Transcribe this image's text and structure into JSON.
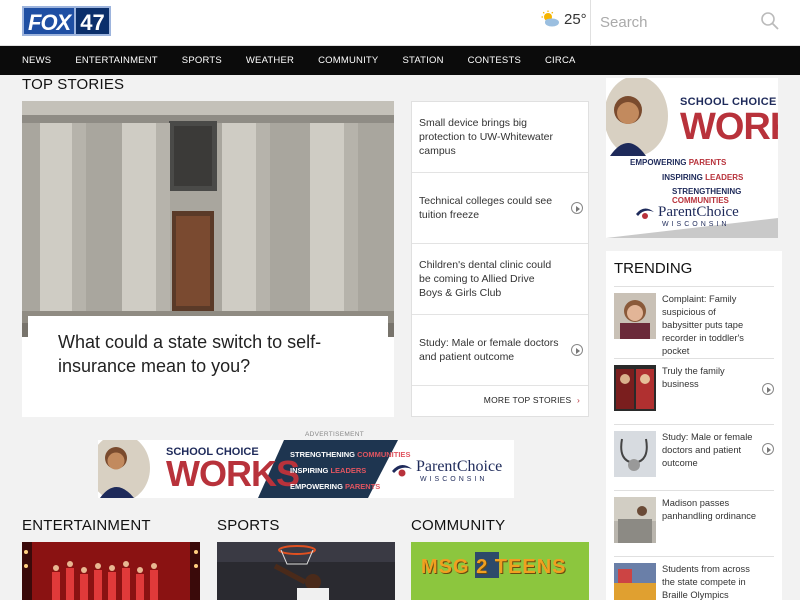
{
  "header": {
    "logo_text": "FOX",
    "logo_number": "47",
    "temperature": "25°",
    "search_placeholder": "Search"
  },
  "nav": {
    "items": [
      {
        "label": "NEWS"
      },
      {
        "label": "ENTERTAINMENT"
      },
      {
        "label": "SPORTS"
      },
      {
        "label": "WEATHER"
      },
      {
        "label": "COMMUNITY"
      },
      {
        "label": "STATION"
      },
      {
        "label": "CONTESTS"
      },
      {
        "label": "CIRCA"
      }
    ]
  },
  "top_stories": {
    "title": "TOP STORIES",
    "hero_headline": "What could a state switch to self-insurance mean to you?",
    "list": [
      {
        "text": "Small device brings big protection to UW-Whitewater campus",
        "video": false
      },
      {
        "text": "Technical colleges could see tuition freeze",
        "video": true
      },
      {
        "text": "Children's dental clinic could be coming to Allied Drive Boys & Girls Club",
        "video": false
      },
      {
        "text": "Study: Male or female doctors and patient outcome",
        "video": true
      }
    ],
    "more_label": "MORE TOP STORIES"
  },
  "ad_right": {
    "line1": "SCHOOL CHOICE",
    "line2": "WORKS",
    "tag1_a": "EMPOWERING",
    "tag1_b": "PARENTS",
    "tag2_a": "INSPIRING",
    "tag2_b": "LEADERS",
    "tag3_a": "STRENGTHENING",
    "tag3_b": "COMMUNITIES",
    "brand": "ParentChoice",
    "brand_sub": "WISCONSIN"
  },
  "trending": {
    "title": "TRENDING",
    "items": [
      {
        "text": "Complaint: Family suspicious of babysitter puts tape recorder in toddler's pocket",
        "video": false
      },
      {
        "text": "Truly the family business",
        "video": true
      },
      {
        "text": "Study: Male or female doctors and patient outcome",
        "video": true
      },
      {
        "text": "Madison passes panhandling ordinance",
        "video": false
      },
      {
        "text": "Students from across the state compete in Braille Olympics",
        "video": false
      }
    ]
  },
  "banner_ad": {
    "label": "ADVERTISEMENT",
    "line1": "SCHOOL CHOICE",
    "line2": "WORKS",
    "tag1_a": "STRENGTHENING",
    "tag1_b": "COMMUNITIES",
    "tag2_a": "INSPIRING",
    "tag2_b": "LEADERS",
    "tag3_a": "EMPOWERING",
    "tag3_b": "PARENTS",
    "brand": "ParentChoice",
    "brand_sub": "WISCONSIN"
  },
  "sections": {
    "entertainment": "ENTERTAINMENT",
    "sports": "SPORTS",
    "community": "COMMUNITY",
    "community_promo": "MSG 2 TEENS"
  },
  "colors": {
    "nav_bg": "#0b0b0b",
    "brand_red": "#b8323b",
    "brand_navy": "#1e2a5a",
    "community_green": "#8cc63e"
  }
}
